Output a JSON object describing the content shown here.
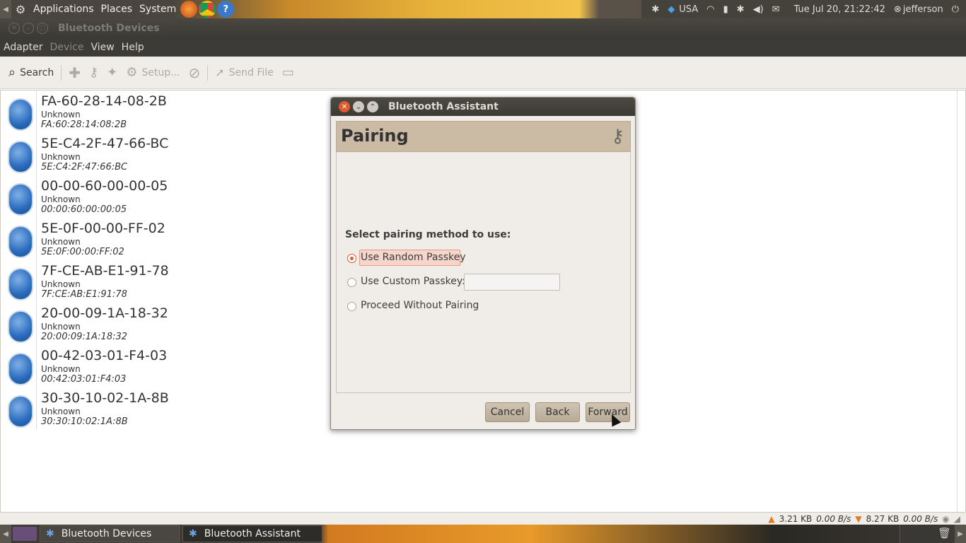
{
  "top_panel": {
    "menus": [
      "Applications",
      "Places",
      "System"
    ],
    "keyboard_layout": "USA",
    "clock": "Tue Jul 20, 21:22:42",
    "user": "jefferson"
  },
  "main_window": {
    "title": "Bluetooth Devices",
    "menubar": [
      "Adapter",
      "Device",
      "View",
      "Help"
    ],
    "toolbar": {
      "search_label": "Search",
      "setup_label": "Setup...",
      "send_file_label": "Send File"
    },
    "devices": [
      {
        "name": "FA-60-28-14-08-2B",
        "type": "Unknown",
        "address": "FA:60:28:14:08:2B"
      },
      {
        "name": "5E-C4-2F-47-66-BC",
        "type": "Unknown",
        "address": "5E:C4:2F:47:66:BC"
      },
      {
        "name": "00-00-60-00-00-05",
        "type": "Unknown",
        "address": "00:00:60:00:00:05"
      },
      {
        "name": "5E-0F-00-00-FF-02",
        "type": "Unknown",
        "address": "5E:0F:00:00:FF:02"
      },
      {
        "name": "7F-CE-AB-E1-91-78",
        "type": "Unknown",
        "address": "7F:CE:AB:E1:91:78"
      },
      {
        "name": "20-00-09-1A-18-32",
        "type": "Unknown",
        "address": "20:00:09:1A:18:32"
      },
      {
        "name": "00-42-03-01-F4-03",
        "type": "Unknown",
        "address": "00:42:03:01:F4:03"
      },
      {
        "name": "30-30-10-02-1A-8B",
        "type": "Unknown",
        "address": "30:30:10:02:1A:8B"
      }
    ],
    "statusbar": {
      "upload_total": "3.21 KB",
      "upload_rate": "0.00 B/s",
      "download_total": "8.27 KB",
      "download_rate": "0.00 B/s"
    }
  },
  "dialog": {
    "title": "Bluetooth Assistant",
    "header": "Pairing",
    "question": "Select pairing method to use:",
    "options": [
      "Use Random Passkey",
      "Use Custom Passkey:",
      "Proceed Without Pairing"
    ],
    "selected_option": "Use Random Passkey",
    "custom_passkey_value": "",
    "buttons": {
      "cancel": "Cancel",
      "back": "Back",
      "forward": "Forward"
    }
  },
  "taskbar": {
    "tasks": [
      "Bluetooth Devices",
      "Bluetooth Assistant"
    ]
  },
  "colors": {
    "accent": "#e05a2b",
    "bluetooth_blue": "#2a6bbd",
    "header_bg": "#cbbba4"
  }
}
